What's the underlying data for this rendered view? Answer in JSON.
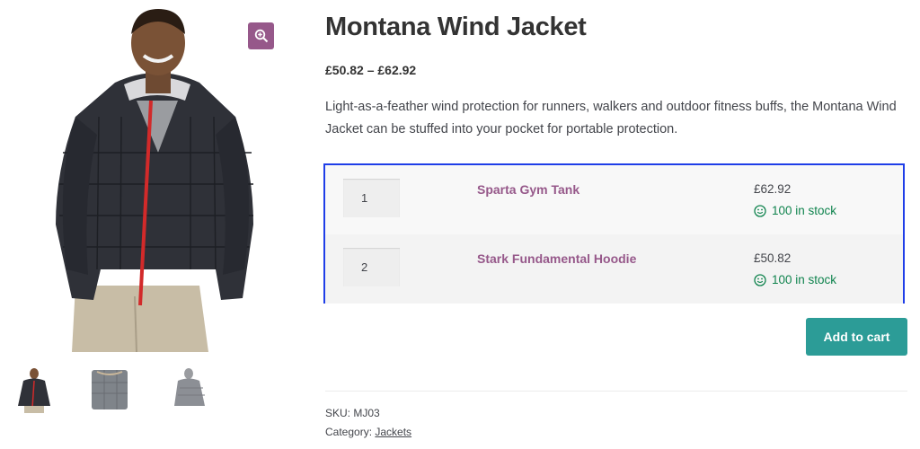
{
  "product": {
    "title": "Montana Wind Jacket",
    "price_range": "£50.82 – £62.92",
    "description": "Light-as-a-feather wind protection for runners, walkers and outdoor fitness buffs, the Montana Wind Jacket can be stuffed into your pocket for portable protection."
  },
  "gallery": {
    "zoom_icon": "zoom-in-icon",
    "thumbnails": [
      "jacket-front-thumbnail",
      "jacket-back-thumbnail",
      "jacket-side-thumbnail"
    ]
  },
  "grouped": {
    "items": [
      {
        "qty": "1",
        "name": "Sparta Gym Tank",
        "price": "£62.92",
        "stock": "100 in stock",
        "stock_icon": "smiley-icon"
      },
      {
        "qty": "2",
        "name": "Stark Fundamental Hoodie",
        "price": "£50.82",
        "stock": "100 in stock",
        "stock_icon": "smiley-icon"
      }
    ]
  },
  "actions": {
    "add_to_cart": "Add to cart"
  },
  "meta": {
    "sku_label": "SKU:",
    "sku": "MJ03",
    "category_label": "Category:",
    "category": "Jackets"
  },
  "colors": {
    "accent_purple": "#96588a",
    "button_teal": "#2c9c97",
    "stock_green": "#0f834d",
    "highlight_border": "#1f3ee8"
  }
}
